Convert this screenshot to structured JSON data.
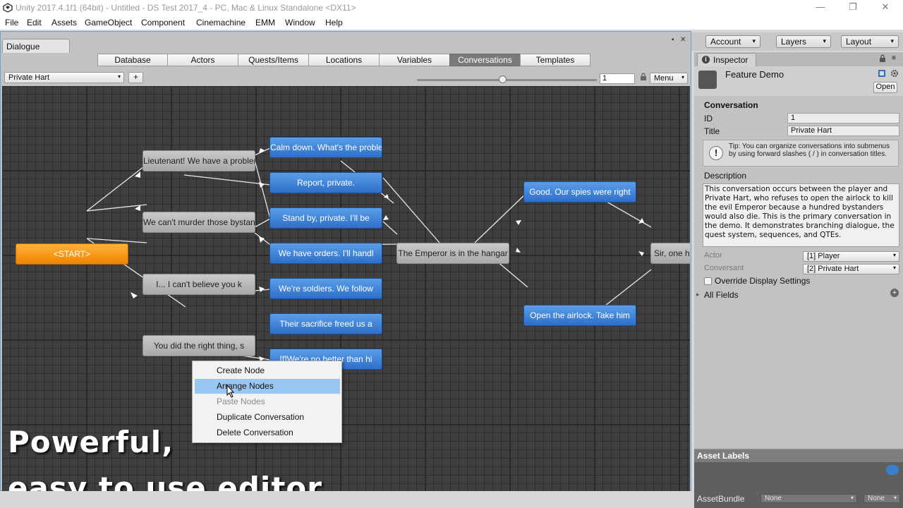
{
  "window": {
    "title": "Unity 2017.4.1f1 (64bit) - Untitled - DS Test 2017_4 - PC, Mac & Linux Standalone <DX11>",
    "minimize_glyph": "—",
    "restore_glyph": "❐",
    "close_glyph": "✕"
  },
  "menubar": [
    "File",
    "Edit",
    "Assets",
    "GameObject",
    "Component",
    "Cinemachine",
    "EMM",
    "Window",
    "Help"
  ],
  "toolbar": {
    "account": "Account",
    "layers": "Layers",
    "layout": "Layout",
    "arrow": "▾"
  },
  "dialogue": {
    "tab": "Dialogue",
    "toolbar_tabs": [
      "Database",
      "Actors",
      "Quests/Items",
      "Locations",
      "Variables",
      "Conversations",
      "Templates"
    ],
    "active_tab": "Conversations",
    "conversation_select": "Private Hart",
    "add_label": "+",
    "zoom_value": "1",
    "menu_label": "Menu",
    "arrow": "▾",
    "close_glyph": "✕",
    "nodes": [
      {
        "id": "start",
        "text": "<START>",
        "type": "orange"
      },
      {
        "id": "n1",
        "text": "Lieutenant! We have a problem",
        "type": "gray"
      },
      {
        "id": "n2",
        "text": "We can't murder those bystanders",
        "type": "gray"
      },
      {
        "id": "n3",
        "text": "I... I can't believe you k",
        "type": "gray"
      },
      {
        "id": "n4",
        "text": "You did the right thing, s",
        "type": "gray"
      },
      {
        "id": "b1",
        "text": "Calm down. What's the problem",
        "type": "blue"
      },
      {
        "id": "b2",
        "text": "Report, private.",
        "type": "blue"
      },
      {
        "id": "b3",
        "text": "Stand by, private. I'll be",
        "type": "blue"
      },
      {
        "id": "b4",
        "text": "We have orders. I'll handl",
        "type": "blue"
      },
      {
        "id": "b5",
        "text": "We're soldiers. We follow",
        "type": "blue"
      },
      {
        "id": "b6",
        "text": "Their sacrifice freed us a",
        "type": "blue"
      },
      {
        "id": "b7",
        "text": "[f]We're no better than hi",
        "type": "blue"
      },
      {
        "id": "e1",
        "text": "The Emperor is in the hangar",
        "type": "gray"
      },
      {
        "id": "g1",
        "text": "Good. Our spies were right",
        "type": "blue"
      },
      {
        "id": "g2",
        "text": "Open the airlock. Take him",
        "type": "blue"
      },
      {
        "id": "s1",
        "text": "Sir, one h",
        "type": "gray"
      }
    ],
    "context_menu": [
      {
        "label": "Create Node",
        "state": "normal"
      },
      {
        "label": "Arrange Nodes",
        "state": "highlighted"
      },
      {
        "label": "Paste Nodes",
        "state": "disabled"
      },
      {
        "label": "Duplicate Conversation",
        "state": "normal"
      },
      {
        "label": "Delete Conversation",
        "state": "normal"
      }
    ],
    "caption_line1": "Powerful,",
    "caption_line2": "easy to use editor"
  },
  "inspector": {
    "tab": "Inspector",
    "info_glyph": "i",
    "object_name": "Feature Demo",
    "open_label": "Open",
    "section": "Conversation",
    "id_label": "ID",
    "id_value": "1",
    "title_label": "Title",
    "title_value": "Private Hart",
    "warn_glyph": "!",
    "tip": "Tip: You can organize conversations into submenus by using forward slashes ( / ) in conversation titles.",
    "description_label": "Description",
    "description": "This conversation occurs between the player and Private Hart, who refuses to open the airlock to kill the evil Emperor because a hundred bystanders would also die. This is the primary conversation in the demo. It demonstrates branching dialogue, the quest system, sequences, and QTEs.",
    "actor_label": "Actor",
    "actor_value": "[1] Player",
    "conversant_label": "Conversant",
    "conversant_value": "[2] Private Hart",
    "override_label": "Override Display Settings",
    "all_fields_label": "All Fields",
    "arrow": "▸",
    "add_glyph": "+"
  },
  "asset_labels": {
    "header": "Asset Labels",
    "assetbundle_label": "AssetBundle",
    "bundle_value": "None",
    "variant_value": "None"
  },
  "colors": {
    "accent_blue": "#2f6fc9",
    "start_orange": "#f08400",
    "canvas": "#3f3f3f",
    "link_arrow_red": "#e00000"
  }
}
